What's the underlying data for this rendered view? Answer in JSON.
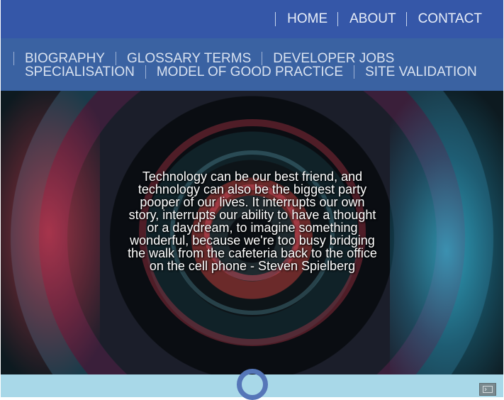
{
  "topnav": {
    "items": [
      {
        "label": "HOME"
      },
      {
        "label": "ABOUT"
      },
      {
        "label": "CONTACT"
      }
    ]
  },
  "subnav": {
    "items": [
      {
        "label": "BIOGRAPHY"
      },
      {
        "label": "GLOSSARY TERMS"
      },
      {
        "label": "DEVELOPER JOBS"
      },
      {
        "label": "SPECIALISATION"
      },
      {
        "label": "MODEL OF GOOD PRACTICE"
      },
      {
        "label": "SITE VALIDATION"
      }
    ]
  },
  "hero": {
    "quote": "Technology can be our best friend, and technology can also be the biggest party pooper of our lives. It interrupts our own story, interrupts our ability to have a thought or a daydream, to imagine something wonderful, because we're too busy bridging the walk from the cafeteria back to the office on the cell phone - Steven Spielberg"
  },
  "colors": {
    "topbar": "#3557a8",
    "subbar": "#3a62a2",
    "footer": "#a8d8e8",
    "loader": "#5576b8"
  },
  "icons": {
    "loader": "loading-ring-icon",
    "terminal": "terminal-icon"
  }
}
